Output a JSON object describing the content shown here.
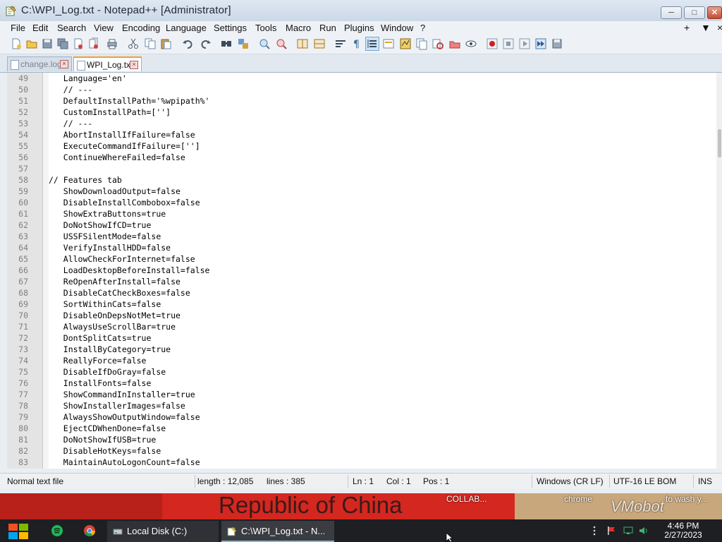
{
  "window": {
    "title": "C:\\WPI_Log.txt - Notepad++ [Administrator]",
    "minimize_glyph": "─",
    "maximize_glyph": "□",
    "close_glyph": "✕"
  },
  "menu": {
    "items": [
      "File",
      "Edit",
      "Search",
      "View",
      "Encoding",
      "Language",
      "Settings",
      "Tools",
      "Macro",
      "Run",
      "Plugins",
      "Window",
      "?"
    ],
    "right": [
      "+",
      "▼",
      "×"
    ]
  },
  "toolbar": {
    "icons": [
      "new-file-icon",
      "open-file-icon",
      "save-icon",
      "save-all-icon",
      "close-icon",
      "close-all-icon",
      "print-icon",
      "cut-icon",
      "copy-icon",
      "paste-icon",
      "undo-icon",
      "redo-icon",
      "find-icon",
      "replace-icon",
      "zoom-in-icon",
      "zoom-out-icon",
      "sync-vertical-icon",
      "sync-horizontal-icon",
      "word-wrap-icon",
      "show-all-chars-icon",
      "indent-guide-icon",
      "udl-icon",
      "doc-map-icon",
      "function-list-icon",
      "folder-workspace-icon",
      "monitoring-icon",
      "record-macro-icon",
      "stop-macro-icon",
      "play-macro-icon",
      "run-macro-multiple-icon",
      "save-macro-icon"
    ]
  },
  "tabs": [
    {
      "label": "change.log",
      "active": false
    },
    {
      "label": "WPI_Log.txt",
      "active": true
    }
  ],
  "editor": {
    "lines": [
      {
        "n": "49",
        "text": "   Language='en'"
      },
      {
        "n": "50",
        "text": "   // ---"
      },
      {
        "n": "51",
        "text": "   DefaultInstallPath='%wpipath%'"
      },
      {
        "n": "52",
        "text": "   CustomInstallPath=['']"
      },
      {
        "n": "53",
        "text": "   // ---"
      },
      {
        "n": "54",
        "text": "   AbortInstallIfFailure=false"
      },
      {
        "n": "55",
        "text": "   ExecuteCommandIfFailure=['']"
      },
      {
        "n": "56",
        "text": "   ContinueWhereFailed=false"
      },
      {
        "n": "57",
        "text": ""
      },
      {
        "n": "58",
        "text": "// Features tab"
      },
      {
        "n": "59",
        "text": "   ShowDownloadOutput=false"
      },
      {
        "n": "60",
        "text": "   DisableInstallCombobox=false"
      },
      {
        "n": "61",
        "text": "   ShowExtraButtons=true"
      },
      {
        "n": "62",
        "text": "   DoNotShowIfCD=true"
      },
      {
        "n": "63",
        "text": "   USSFSilentMode=false"
      },
      {
        "n": "64",
        "text": "   VerifyInstallHDD=false"
      },
      {
        "n": "65",
        "text": "   AllowCheckForInternet=false"
      },
      {
        "n": "66",
        "text": "   LoadDesktopBeforeInstall=false"
      },
      {
        "n": "67",
        "text": "   ReOpenAfterInstall=false"
      },
      {
        "n": "68",
        "text": "   DisableCatCheckBoxes=false"
      },
      {
        "n": "69",
        "text": "   SortWithinCats=false"
      },
      {
        "n": "70",
        "text": "   DisableOnDepsNotMet=true"
      },
      {
        "n": "71",
        "text": "   AlwaysUseScrollBar=true"
      },
      {
        "n": "72",
        "text": "   DontSplitCats=true"
      },
      {
        "n": "73",
        "text": "   InstallByCategory=true"
      },
      {
        "n": "74",
        "text": "   ReallyForce=false"
      },
      {
        "n": "75",
        "text": "   DisableIfDoGray=false"
      },
      {
        "n": "76",
        "text": "   InstallFonts=false"
      },
      {
        "n": "77",
        "text": "   ShowCommandInInstaller=true"
      },
      {
        "n": "78",
        "text": "   ShowInstallerImages=false"
      },
      {
        "n": "79",
        "text": "   AlwaysShowOutputWindow=false"
      },
      {
        "n": "80",
        "text": "   EjectCDWhenDone=false"
      },
      {
        "n": "81",
        "text": "   DoNotShowIfUSB=true"
      },
      {
        "n": "82",
        "text": "   DisableHotKeys=false"
      },
      {
        "n": "83",
        "text": "   MaintainAutoLogonCount=false"
      }
    ]
  },
  "status": {
    "file_type": "Normal text file",
    "length": "length : 12,085",
    "lines": "lines : 385",
    "ln": "Ln : 1",
    "col": "Col : 1",
    "pos": "Pos : 1",
    "eol": "Windows (CR LF)",
    "encoding": "UTF-16 LE BOM",
    "mode": "INS"
  },
  "desktop": {
    "big_text": "Republic of China",
    "labels": [
      "COLLAB...",
      "chrome",
      "to wash y..."
    ],
    "watermark": "VMobot"
  },
  "taskbar": {
    "tasks": [
      {
        "label": "Local Disk (C:)"
      },
      {
        "label": "C:\\WPI_Log.txt - N..."
      }
    ],
    "clock_time": "4:46 PM",
    "clock_date": "2/27/2023"
  },
  "colors": {
    "title_bg": "#cbd8e6",
    "editor_bg": "#ffffff",
    "gutter_bg": "#e4e4e4",
    "taskbar_bg": "#1e1f22",
    "desktop_red": "#c8261e"
  }
}
